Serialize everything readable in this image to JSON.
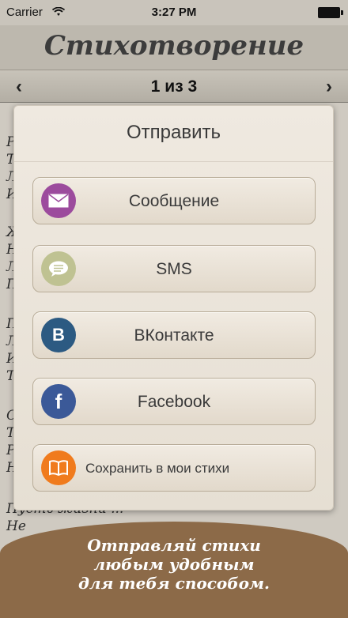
{
  "status_bar": {
    "carrier": "Carrier",
    "time": "3:27 PM"
  },
  "header": {
    "title": "Стихотворение"
  },
  "pager": {
    "counter": "1 из 3"
  },
  "poem": {
    "lines": [
      "Р",
      "Т",
      "Л",
      "И",
      "Ж",
      "Н",
      "Л",
      "П",
      "П",
      "Л",
      "И",
      "Т",
      "С",
      "Т",
      "Р",
      "Н",
      "Пусть жизни ...",
      "Не"
    ]
  },
  "dialog": {
    "title": "Отправить",
    "options": [
      {
        "label": "Сообщение",
        "icon": "mail-icon",
        "color": "#9c4b9d"
      },
      {
        "label": "SMS",
        "icon": "chat-bubble-icon",
        "color": "#bfc292"
      },
      {
        "label": "ВКонтакте",
        "icon": "vk-icon",
        "color": "#2c5a82"
      },
      {
        "label": "Facebook",
        "icon": "facebook-icon",
        "color": "#3b5998"
      },
      {
        "label": "Сохранить в мои стихи",
        "icon": "book-icon",
        "color": "#f07b1d"
      }
    ]
  },
  "caption": {
    "lines": [
      "Отправляй стихи",
      "любым удобным",
      "для тебя способом."
    ]
  }
}
